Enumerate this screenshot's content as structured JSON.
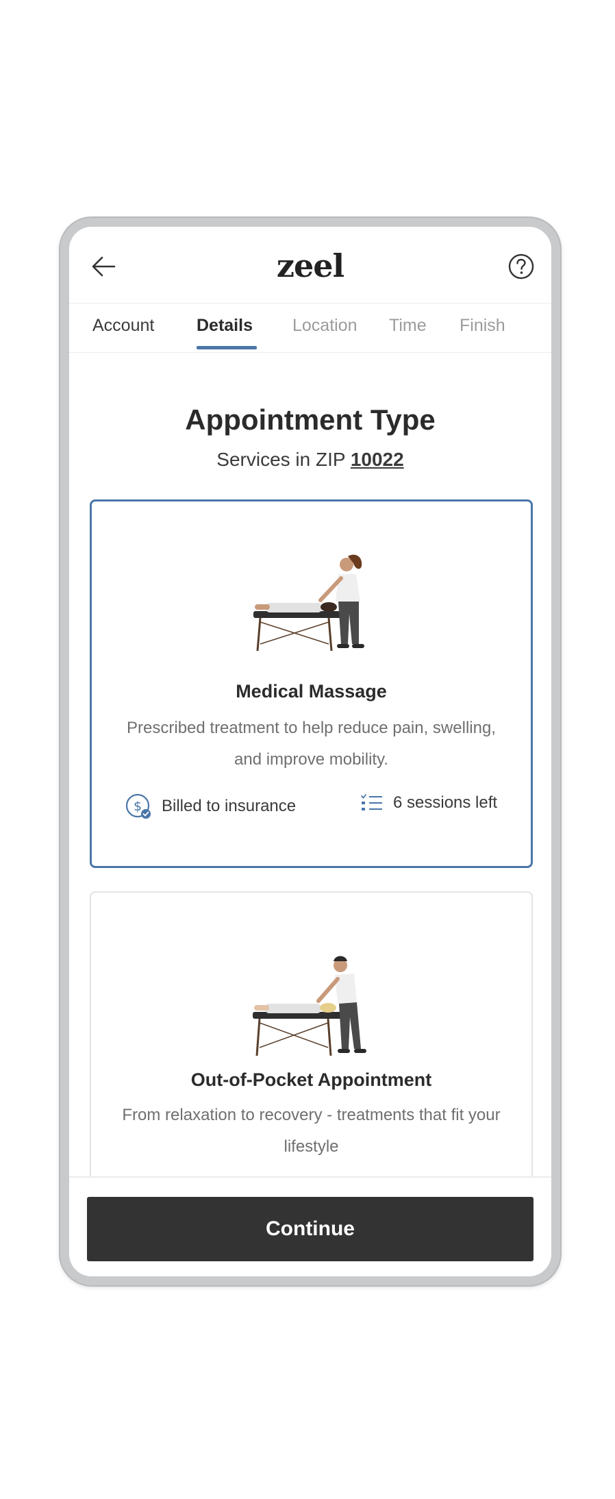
{
  "header": {
    "logo": "zeel"
  },
  "tabs": [
    {
      "label": "Account"
    },
    {
      "label": "Details"
    },
    {
      "label": "Location"
    },
    {
      "label": "Time"
    },
    {
      "label": "Finish"
    }
  ],
  "main": {
    "title": "Appointment Type",
    "zip_prefix": "Services in ZIP ",
    "zip_value": "10022"
  },
  "cards": [
    {
      "title": "Medical Massage",
      "description": "Prescribed treatment to help reduce pain, swelling, and improve mobility.",
      "billing_label": "Billed to insurance",
      "sessions_label": "6 sessions left",
      "selected": true
    },
    {
      "title": "Out-of-Pocket Appointment",
      "description": "From relaxation to recovery - treatments that fit your lifestyle",
      "selected": false
    }
  ],
  "footer": {
    "continue_label": "Continue"
  },
  "colors": {
    "accent": "#4a76a8",
    "button": "#333333",
    "frame": "#c9cacc"
  },
  "icons": [
    "back-arrow-icon",
    "help-icon",
    "insurance-dollar-icon",
    "sessions-list-icon"
  ]
}
